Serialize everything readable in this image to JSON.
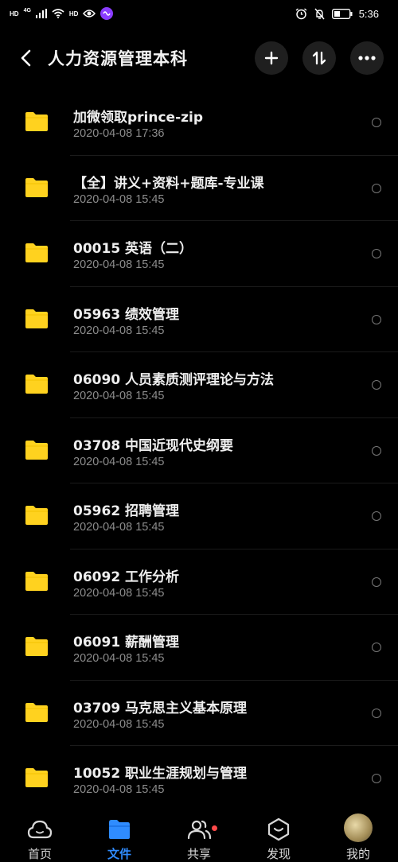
{
  "status_bar": {
    "hd1": "HD",
    "net": "4G",
    "hd2": "HD",
    "time": "5:36"
  },
  "header": {
    "title": "人力资源管理本科"
  },
  "files": [
    {
      "name": "加微领取prince-zip",
      "date": "2020-04-08  17:36"
    },
    {
      "name": "【全】讲义+资料+题库-专业课",
      "date": "2020-04-08  15:45"
    },
    {
      "name": "00015 英语（二）",
      "date": "2020-04-08  15:45"
    },
    {
      "name": "05963 绩效管理",
      "date": "2020-04-08  15:45"
    },
    {
      "name": "06090 人员素质测评理论与方法",
      "date": "2020-04-08  15:45"
    },
    {
      "name": "03708 中国近现代史纲要",
      "date": "2020-04-08  15:45"
    },
    {
      "name": "05962 招聘管理",
      "date": "2020-04-08  15:45"
    },
    {
      "name": "06092 工作分析",
      "date": "2020-04-08  15:45"
    },
    {
      "name": "06091 薪酬管理",
      "date": "2020-04-08  15:45"
    },
    {
      "name": "03709 马克思主义基本原理",
      "date": "2020-04-08  15:45"
    },
    {
      "name": "10052 职业生涯规划与管理",
      "date": "2020-04-08  15:45"
    }
  ],
  "nav": {
    "tabs": [
      {
        "label": "首页",
        "icon": "cloud-icon",
        "active": false
      },
      {
        "label": "文件",
        "icon": "folder-icon",
        "active": true
      },
      {
        "label": "共享",
        "icon": "people-icon",
        "active": false,
        "badge": true
      },
      {
        "label": "发现",
        "icon": "compass-icon",
        "active": false
      },
      {
        "label": "我的",
        "icon": "avatar",
        "active": false
      }
    ]
  },
  "colors": {
    "background": "#000000",
    "folder": "#ffd21f",
    "accent": "#2f8cff",
    "badge": "#ff4a4a",
    "secondary_text": "#8c8c8c"
  }
}
